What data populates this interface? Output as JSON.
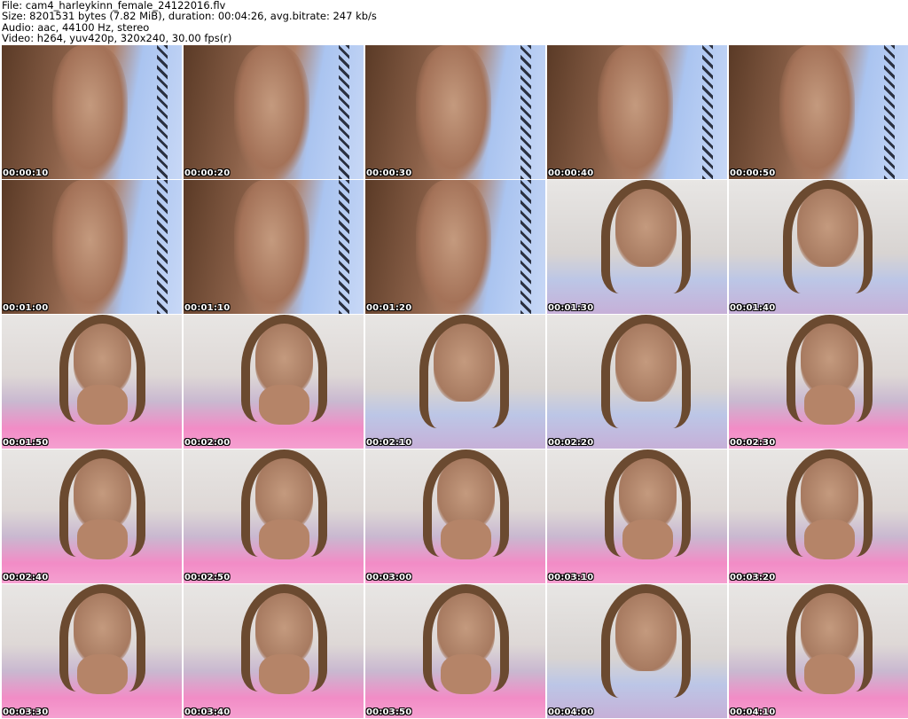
{
  "header": {
    "file_line": "File: cam4_harleykinn_female_24122016.flv",
    "size_line": "Size: 8201531 bytes (7.82 MiB), duration: 00:04:26, avg.bitrate: 247 kb/s",
    "audio_line": "Audio: aac, 44100 Hz, stereo",
    "video_line": "Video: h264, yuv420p, 320x240, 30.00 fps(r)"
  },
  "thumbnails": [
    {
      "time": "00:00:10",
      "scene": "blue-closeup"
    },
    {
      "time": "00:00:20",
      "scene": "blue-closeup"
    },
    {
      "time": "00:00:30",
      "scene": "blue-closeup"
    },
    {
      "time": "00:00:40",
      "scene": "blue-closeup"
    },
    {
      "time": "00:00:50",
      "scene": "blue-closeup"
    },
    {
      "time": "00:01:00",
      "scene": "blue-closeup"
    },
    {
      "time": "00:01:10",
      "scene": "blue-closeup"
    },
    {
      "time": "00:01:20",
      "scene": "blue-closeup"
    },
    {
      "time": "00:01:30",
      "scene": "pillow-rest"
    },
    {
      "time": "00:01:40",
      "scene": "pillow-rest"
    },
    {
      "time": "00:01:50",
      "scene": "pink-rest"
    },
    {
      "time": "00:02:00",
      "scene": "pink-rest"
    },
    {
      "time": "00:02:10",
      "scene": "pillow-rest"
    },
    {
      "time": "00:02:20",
      "scene": "pillow-rest"
    },
    {
      "time": "00:02:30",
      "scene": "pink-rest"
    },
    {
      "time": "00:02:40",
      "scene": "pink-rest"
    },
    {
      "time": "00:02:50",
      "scene": "pink-rest"
    },
    {
      "time": "00:03:00",
      "scene": "pink-rest"
    },
    {
      "time": "00:03:10",
      "scene": "pink-rest"
    },
    {
      "time": "00:03:20",
      "scene": "pink-rest"
    },
    {
      "time": "00:03:30",
      "scene": "pink-rest"
    },
    {
      "time": "00:03:40",
      "scene": "pink-rest"
    },
    {
      "time": "00:03:50",
      "scene": "pink-rest"
    },
    {
      "time": "00:04:00",
      "scene": "pillow-rest"
    },
    {
      "time": "00:04:10",
      "scene": "pink-rest"
    }
  ],
  "colors": {
    "timestamp_text": "#ffffff",
    "timestamp_outline": "#000000",
    "blue_bg": "#aac4f0",
    "pink_bg": "#f28cc6",
    "pillow_bg": "#bcc6e6",
    "skin": "#b08066",
    "hair": "#6b4a30",
    "wall": "#e8e6e4"
  }
}
